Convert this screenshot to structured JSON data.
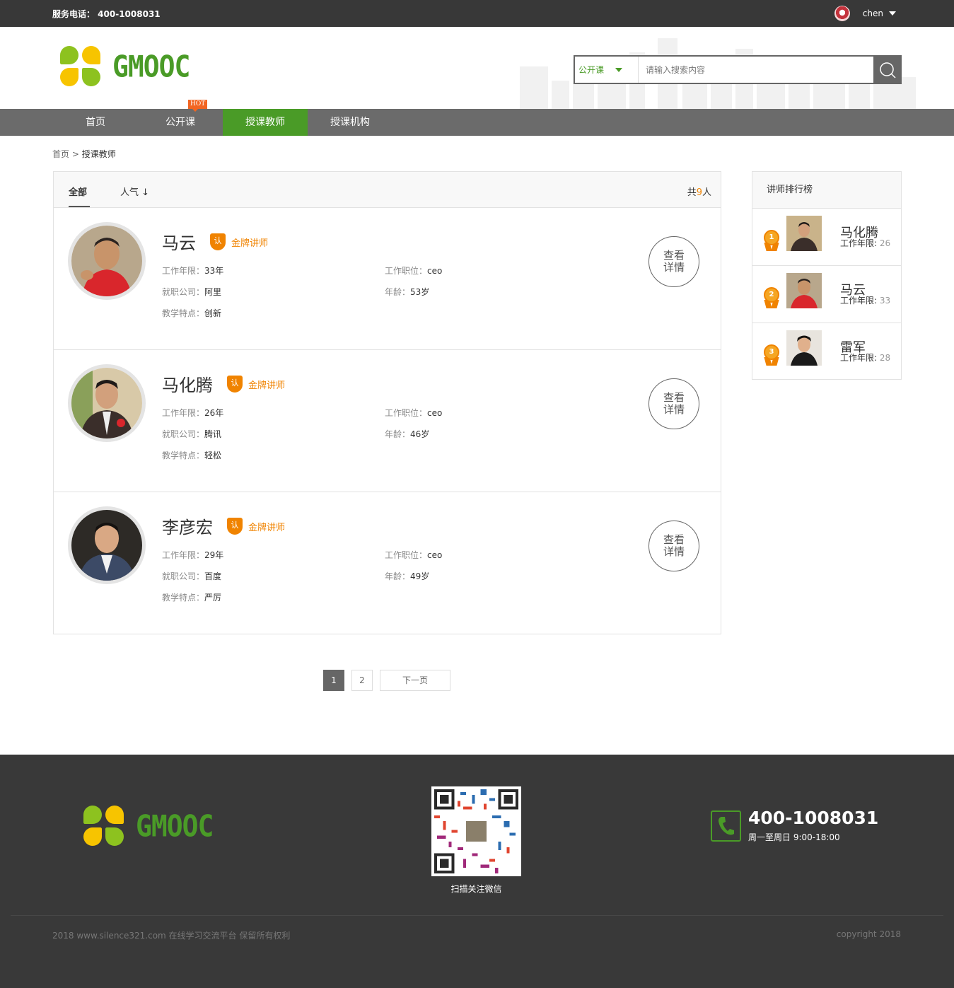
{
  "topbar": {
    "phone": "服务电话： 400-1008031",
    "username": "chen"
  },
  "header": {
    "logo_text": "GMOOC",
    "search": {
      "scope": "公开课",
      "placeholder": "请输入搜索内容"
    }
  },
  "nav": {
    "items": [
      {
        "label": "首页"
      },
      {
        "label": "公开课"
      },
      {
        "label": "授课教师"
      },
      {
        "label": "授课机构"
      }
    ],
    "active": "授课教师",
    "hot_badge": "HOT"
  },
  "breadcrumb": {
    "home": "首页",
    "sep": ">",
    "current": "授课教师"
  },
  "list": {
    "tab_all": "全部",
    "tab_popular": "人气 ↓",
    "total_prefix": "共",
    "total_count": "9",
    "total_suffix": "人",
    "detail_label_1": "查看",
    "detail_label_2": "详情",
    "badge_label": "金牌讲师",
    "badge_icon_text": "认",
    "teachers": [
      {
        "name": "马云",
        "years_label": "工作年限：",
        "years": "33年",
        "position_label": "工作职位：",
        "position": "ceo",
        "company_label": "就职公司：",
        "company": "阿里",
        "age_label": "年龄：",
        "age": "53岁",
        "feature_label": "教学特点：",
        "feature": "创新"
      },
      {
        "name": "马化腾",
        "years_label": "工作年限：",
        "years": "26年",
        "position_label": "工作职位：",
        "position": "ceo",
        "company_label": "就职公司：",
        "company": "腾讯",
        "age_label": "年龄：",
        "age": "46岁",
        "feature_label": "教学特点：",
        "feature": "轻松"
      },
      {
        "name": "李彦宏",
        "years_label": "工作年限：",
        "years": "29年",
        "position_label": "工作职位：",
        "position": "ceo",
        "company_label": "就职公司：",
        "company": "百度",
        "age_label": "年龄：",
        "age": "49岁",
        "feature_label": "教学特点：",
        "feature": "严厉"
      }
    ]
  },
  "pager": {
    "pages": [
      "1",
      "2"
    ],
    "current": "1",
    "next": "下一页"
  },
  "ranking": {
    "title": "讲师排行榜",
    "items": [
      {
        "rank": "1",
        "name": "马化腾",
        "years_label": "工作年限:",
        "years": "26"
      },
      {
        "rank": "2",
        "name": "马云",
        "years_label": "工作年限:",
        "years": "33"
      },
      {
        "rank": "3",
        "name": "雷军",
        "years_label": "工作年限:",
        "years": "28"
      }
    ]
  },
  "footer": {
    "logo_text": "GMOOC",
    "qr_caption": "扫描关注微信",
    "phone": "400-1008031",
    "hours": "周一至周日 9:00-18:00",
    "copyright_left": "2018 www.silence321.com 在线学习交流平台 保留所有权利",
    "copyright_right": "copyright 2018"
  },
  "colors": {
    "brand_green": "#4a9b27",
    "accent_orange": "#f08300",
    "topbar_bg": "#383838",
    "nav_bg": "#6b6b6b",
    "footer_bg": "#393939"
  }
}
